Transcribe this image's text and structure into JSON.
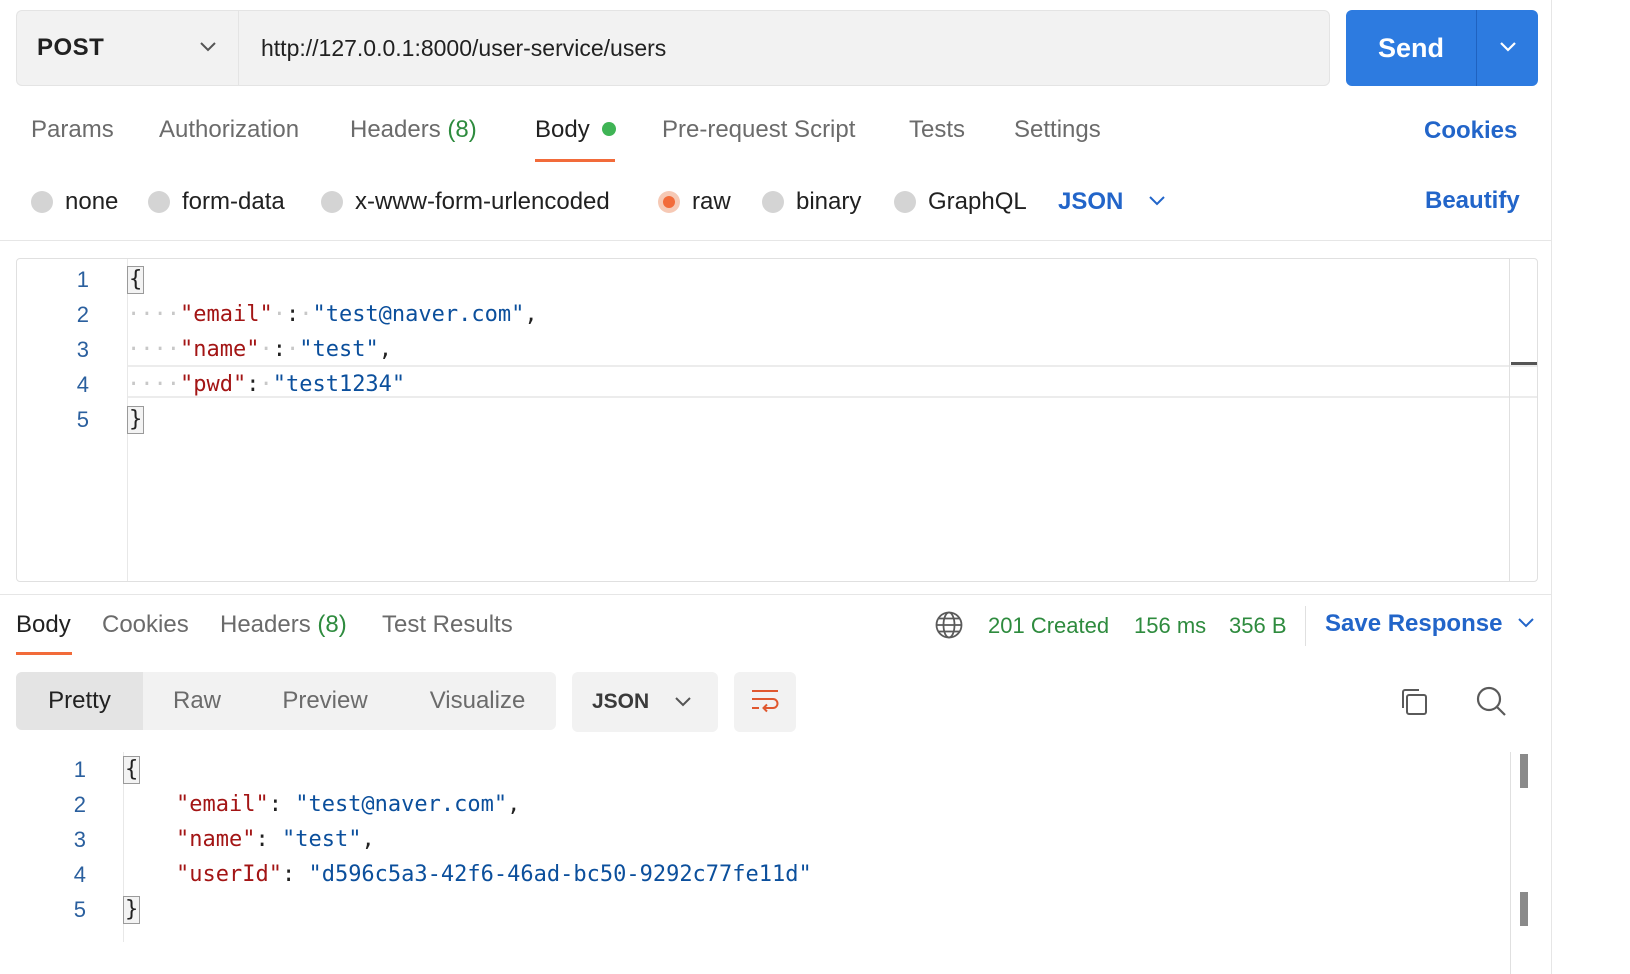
{
  "request": {
    "method": "POST",
    "url": "http://127.0.0.1:8000/user-service/users",
    "send_label": "Send"
  },
  "request_tabs": {
    "params": "Params",
    "authorization": "Authorization",
    "headers": "Headers",
    "headers_count": "(8)",
    "body": "Body",
    "prerequest": "Pre-request Script",
    "tests": "Tests",
    "settings": "Settings",
    "cookies": "Cookies"
  },
  "body_types": {
    "none": "none",
    "form_data": "form-data",
    "urlencoded": "x-www-form-urlencoded",
    "raw": "raw",
    "binary": "binary",
    "graphql": "GraphQL",
    "language": "JSON",
    "beautify": "Beautify",
    "selected": "raw"
  },
  "request_body": {
    "line_numbers": [
      "1",
      "2",
      "3",
      "4",
      "5"
    ],
    "open_brace": "{",
    "close_brace": "}",
    "fields": [
      {
        "key": "\"email\"",
        "value": "\"test@naver.com\""
      },
      {
        "key": "\"name\"",
        "value": "\"test\""
      },
      {
        "key": "\"pwd\"",
        "value": "\"test1234\""
      }
    ]
  },
  "response_tabs": {
    "body": "Body",
    "cookies": "Cookies",
    "headers": "Headers",
    "headers_count": "(8)",
    "test_results": "Test Results"
  },
  "response_meta": {
    "status": "201 Created",
    "time": "156 ms",
    "size": "356 B",
    "save_response": "Save Response"
  },
  "view_modes": {
    "pretty": "Pretty",
    "raw": "Raw",
    "preview": "Preview",
    "visualize": "Visualize",
    "format": "JSON"
  },
  "response_body": {
    "line_numbers": [
      "1",
      "2",
      "3",
      "4",
      "5"
    ],
    "open_brace": "{",
    "close_brace": "}",
    "fields": [
      {
        "key": "\"email\"",
        "value": "\"test@naver.com\""
      },
      {
        "key": "\"name\"",
        "value": "\"test\""
      },
      {
        "key": "\"userId\"",
        "value": "\"d596c5a3-42f6-46ad-bc50-9292c77fe11d\""
      }
    ]
  },
  "colors": {
    "accent_blue": "#2d7be0",
    "tab_underline": "#f26b3a",
    "status_green": "#2e8b3e",
    "json_key": "#a31515",
    "json_string": "#0b4f9c"
  },
  "icons": {
    "method_dropdown": "chevron-down-icon",
    "send_dropdown": "chevron-down-icon",
    "body_indicator": "green-dot-icon",
    "language_dropdown": "chevron-down-icon",
    "network": "globe-icon",
    "save_dropdown": "chevron-down-icon",
    "wrap": "wrap-lines-icon",
    "copy": "copy-icon",
    "search": "search-icon"
  }
}
